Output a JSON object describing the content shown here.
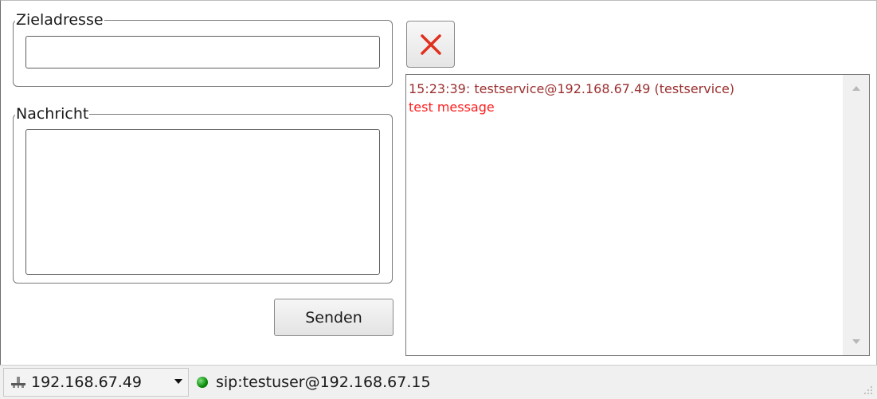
{
  "form": {
    "target_legend": "Zieladresse",
    "target_value": "",
    "message_legend": "Nachricht",
    "message_value": "",
    "send_label": "Senden"
  },
  "log": {
    "lines": [
      "15:23:39: testservice@192.168.67.49 (testservice)",
      "test message"
    ]
  },
  "statusbar": {
    "ip": "192.168.67.49",
    "sip": "sip:testuser@192.168.67.15",
    "connection_color": "#0a8a0a"
  },
  "icons": {
    "close": "close-icon",
    "network": "network-icon",
    "status": "status-dot-icon"
  },
  "colors": {
    "close_x": "#e0301e",
    "log_header": "#9b2f2f",
    "log_message": "#ff1e1e"
  }
}
